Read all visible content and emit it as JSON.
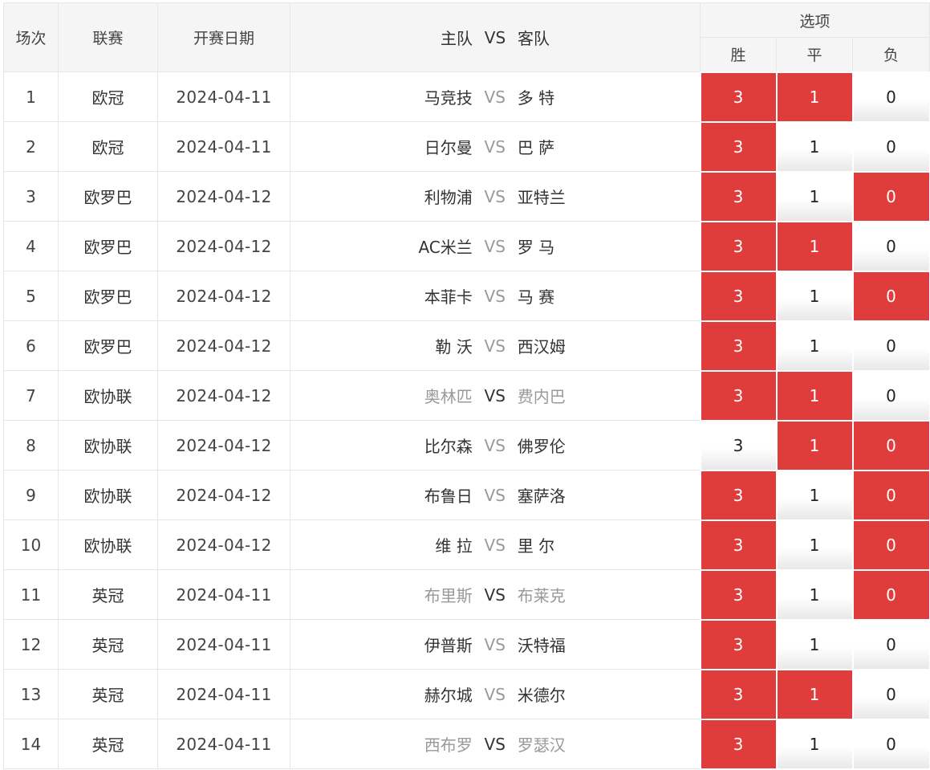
{
  "header": {
    "col_no": "场次",
    "col_league": "联赛",
    "col_date": "开赛日期",
    "col_home": "主队",
    "col_vs": "VS",
    "col_away": "客队",
    "col_options": "选项",
    "opt_win": "胜",
    "opt_draw": "平",
    "opt_loss": "负"
  },
  "colors": {
    "selected": "#e03c3c",
    "muted_team": "#999999"
  },
  "rows": [
    {
      "no": "1",
      "league": "欧冠",
      "date": "2024-04-11",
      "home": "马竞技",
      "vs": "VS",
      "away": "多 特",
      "win": "3",
      "draw": "1",
      "loss": "0"
    },
    {
      "no": "2",
      "league": "欧冠",
      "date": "2024-04-11",
      "home": "日尔曼",
      "vs": "VS",
      "away": "巴 萨",
      "win": "3",
      "draw": "1",
      "loss": "0"
    },
    {
      "no": "3",
      "league": "欧罗巴",
      "date": "2024-04-12",
      "home": "利物浦",
      "vs": "VS",
      "away": "亚特兰",
      "win": "3",
      "draw": "1",
      "loss": "0"
    },
    {
      "no": "4",
      "league": "欧罗巴",
      "date": "2024-04-12",
      "home": "AC米兰",
      "vs": "VS",
      "away": "罗 马",
      "win": "3",
      "draw": "1",
      "loss": "0"
    },
    {
      "no": "5",
      "league": "欧罗巴",
      "date": "2024-04-12",
      "home": "本菲卡",
      "vs": "VS",
      "away": "马 赛",
      "win": "3",
      "draw": "1",
      "loss": "0"
    },
    {
      "no": "6",
      "league": "欧罗巴",
      "date": "2024-04-12",
      "home": "勒 沃",
      "vs": "VS",
      "away": "西汉姆",
      "win": "3",
      "draw": "1",
      "loss": "0"
    },
    {
      "no": "7",
      "league": "欧协联",
      "date": "2024-04-12",
      "home": "奥林匹",
      "vs": "VS",
      "away": "费内巴",
      "win": "3",
      "draw": "1",
      "loss": "0"
    },
    {
      "no": "8",
      "league": "欧协联",
      "date": "2024-04-12",
      "home": "比尔森",
      "vs": "VS",
      "away": "佛罗伦",
      "win": "3",
      "draw": "1",
      "loss": "0"
    },
    {
      "no": "9",
      "league": "欧协联",
      "date": "2024-04-12",
      "home": "布鲁日",
      "vs": "VS",
      "away": "塞萨洛",
      "win": "3",
      "draw": "1",
      "loss": "0"
    },
    {
      "no": "10",
      "league": "欧协联",
      "date": "2024-04-12",
      "home": "维 拉",
      "vs": "VS",
      "away": "里 尔",
      "win": "3",
      "draw": "1",
      "loss": "0"
    },
    {
      "no": "11",
      "league": "英冠",
      "date": "2024-04-11",
      "home": "布里斯",
      "vs": "VS",
      "away": "布莱克",
      "win": "3",
      "draw": "1",
      "loss": "0"
    },
    {
      "no": "12",
      "league": "英冠",
      "date": "2024-04-11",
      "home": "伊普斯",
      "vs": "VS",
      "away": "沃特福",
      "win": "3",
      "draw": "1",
      "loss": "0"
    },
    {
      "no": "13",
      "league": "英冠",
      "date": "2024-04-11",
      "home": "赫尔城",
      "vs": "VS",
      "away": "米德尔",
      "win": "3",
      "draw": "1",
      "loss": "0"
    },
    {
      "no": "14",
      "league": "英冠",
      "date": "2024-04-11",
      "home": "西布罗",
      "vs": "VS",
      "away": "罗瑟汉",
      "win": "3",
      "draw": "1",
      "loss": "0"
    }
  ]
}
